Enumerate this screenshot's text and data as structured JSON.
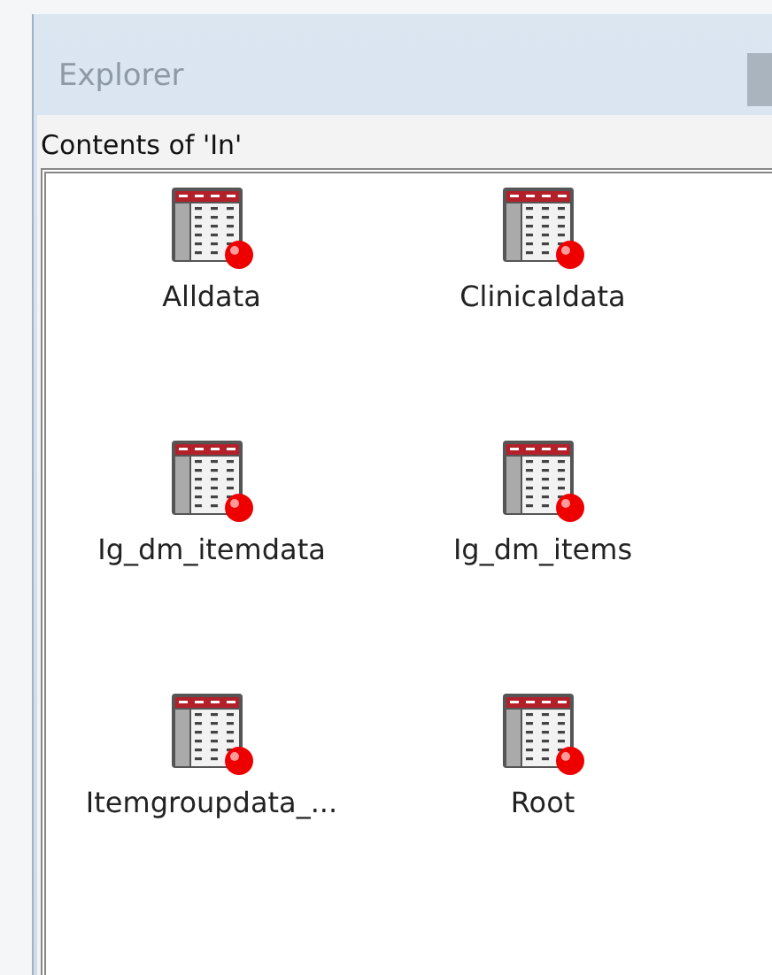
{
  "window": {
    "title": "Explorer"
  },
  "panel": {
    "heading": "Contents of 'In'"
  },
  "items": [
    {
      "label": "Alldata"
    },
    {
      "label": "Clinicaldata"
    },
    {
      "label": "Ig_dm_itemdata"
    },
    {
      "label": "Ig_dm_items"
    },
    {
      "label": "Itemgroupdata_..."
    },
    {
      "label": "Root"
    }
  ]
}
